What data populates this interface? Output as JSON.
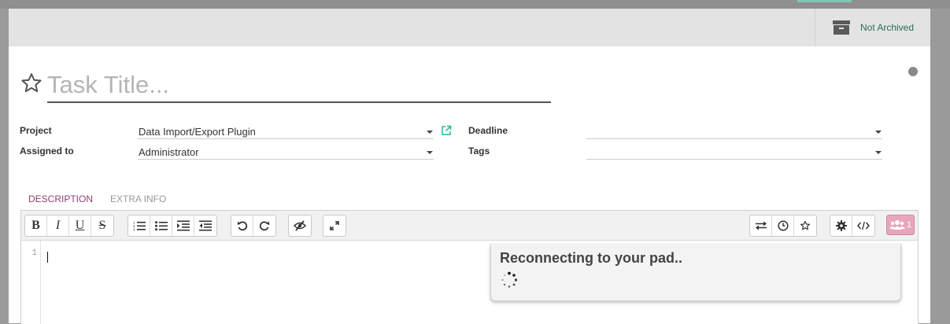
{
  "status_bar": {
    "archive_label": "Not Archived"
  },
  "task": {
    "title_placeholder": "Task Title..."
  },
  "fields": {
    "project_label": "Project",
    "project_value": "Data Import/Export Plugin",
    "assigned_label": "Assigned to",
    "assigned_value": "Administrator",
    "deadline_label": "Deadline",
    "deadline_value": "",
    "tags_label": "Tags",
    "tags_value": ""
  },
  "tabs": [
    {
      "label": "DESCRIPTION",
      "active": true
    },
    {
      "label": "EXTRA INFO",
      "active": false
    }
  ],
  "toolbar": {
    "bold": "B",
    "italic": "I",
    "underline": "U",
    "strike": "S",
    "users_count": "1"
  },
  "editor": {
    "line_number": "1",
    "popup_title": "Reconnecting to your pad.."
  },
  "colors": {
    "accent": "#8f3f71",
    "archive_text": "#2a6e52",
    "link_icon": "#21b799",
    "users_btn": "#e7a6bc"
  },
  "icons": {
    "star": "star-outline-icon",
    "archive": "archive-box-icon",
    "external_link": "external-link-icon",
    "users": "users-icon"
  }
}
